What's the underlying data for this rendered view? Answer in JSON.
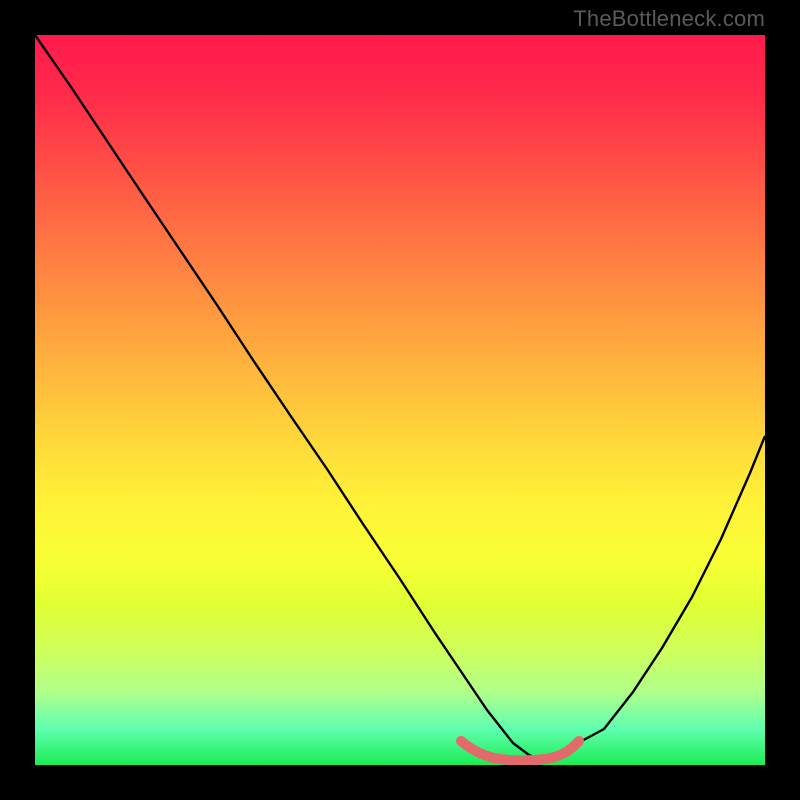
{
  "watermark": "TheBottleneck.com",
  "chart_data": {
    "type": "line",
    "title": "",
    "xlabel": "",
    "ylabel": "",
    "xlim": [
      0,
      100
    ],
    "ylim": [
      0,
      100
    ],
    "series": [
      {
        "name": "black-curve",
        "color": "#000000",
        "x": [
          0,
          5,
          10,
          15,
          20,
          25,
          30,
          35,
          40,
          45,
          50,
          55,
          58,
          62,
          66,
          70,
          74,
          78,
          82,
          86,
          90,
          94,
          98,
          100
        ],
        "y": [
          100,
          93,
          85.5,
          78,
          70.5,
          63,
          55.5,
          48,
          40.5,
          33,
          25.5,
          18,
          13,
          7,
          2.5,
          1,
          2,
          5,
          10,
          16,
          23,
          31,
          40,
          45
        ]
      },
      {
        "name": "red-bottom-segment",
        "color": "#e26a6a",
        "x": [
          58,
          60,
          62,
          64,
          66,
          68,
          70,
          72,
          74
        ],
        "y": [
          3.2,
          2.0,
          1.4,
          1.1,
          1.0,
          1.1,
          1.4,
          2.0,
          3.2
        ]
      }
    ],
    "background_gradient": {
      "top_color": "#ff1a4d",
      "mid_color": "#ffd93a",
      "bottom_color": "#1cec52"
    }
  }
}
